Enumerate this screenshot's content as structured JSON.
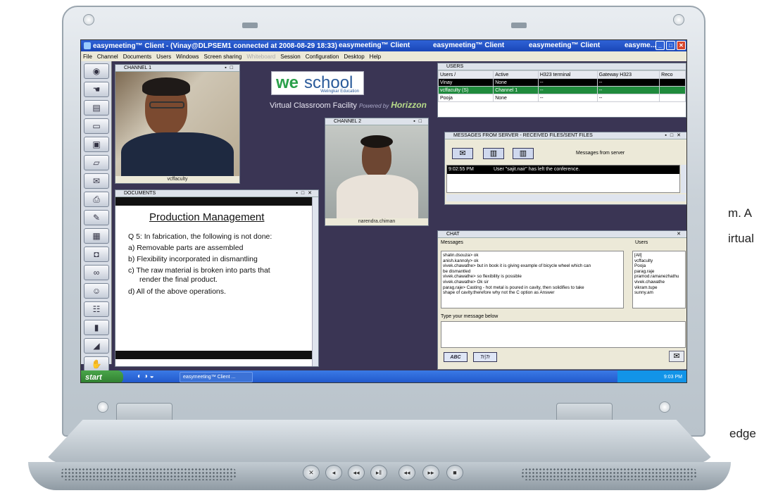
{
  "background_text": {
    "line1": "m. A",
    "line2": "irtual",
    "line3": "edge"
  },
  "window": {
    "title": "easymeeting™ Client - (Vinay@DLPSEM1 connected at 2008-08-29 18:33)",
    "title_seg2": "easymeeting™ Client",
    "title_seg3": "easymeeting™ Client",
    "title_seg4": "easymeeting™ Client",
    "title_seg5": "easyme..."
  },
  "menu": [
    "File",
    "Channel",
    "Documents",
    "Users",
    "Windows",
    "Screen sharing",
    "Whiteboard",
    "Session",
    "Configuration",
    "Desktop",
    "Help"
  ],
  "menu_disabled": "Whiteboard",
  "logo": {
    "we": "we",
    "school": "school",
    "sub": "Welingkar Education"
  },
  "tagline": {
    "main": "Virtual Classroom Facility",
    "powered": "Powered by",
    "brand": "Horizzon"
  },
  "channel1": {
    "title": "CHANNEL 1",
    "caption": "vcffaculty"
  },
  "channel2": {
    "title": "CHANNEL 2",
    "caption": "narendra.chiman"
  },
  "documents": {
    "title": "DOCUMENTS",
    "heading": "Production Management",
    "question": "Q 5: In fabrication, the following is not done:",
    "a": "a)  Removable parts are assembled",
    "b": "b)  Flexibility incorporated in dismantling",
    "c1": "c)  The raw material is broken into parts that",
    "c2": "render the final product.",
    "d": "d)  All of the above operations."
  },
  "users": {
    "title": "USERS",
    "headers": [
      "Users /",
      "Active",
      "H323 terminal",
      "Gateway H323",
      "Reco"
    ],
    "rows": [
      {
        "user": "Vinay",
        "active": "None",
        "h323": "--",
        "gw": "--"
      },
      {
        "user": "vcffaculty (S)",
        "active": "Channel 1",
        "h323": "--",
        "gw": "--"
      },
      {
        "user": "Pooja",
        "active": "None",
        "h323": "--",
        "gw": "--"
      }
    ]
  },
  "messages": {
    "title": "MESSAGES FROM SERVER - RECEIVED FILES/SENT FILES",
    "label": "Messages from server",
    "time": "9:02:55 PM",
    "text": "User \"sajit.nair\" has left the conference."
  },
  "chat": {
    "title": "CHAT",
    "messages_label": "Messages",
    "users_label": "Users",
    "lines": [
      "shalin.dsouza> ok",
      "anish.kannoly> ok",
      "vivek.chawathe> but in book it is giving example of bicycle wheel which can",
      "be dismantled",
      "vivek.chawathe> so flexibility is possible",
      "vivek.chawathe> Ok sir",
      "parag.raje> Casting - hot metal is poured in cavity, then solidifies to take",
      "shape of cavity.therefore why not the C option as Answer"
    ],
    "users": [
      "[All]",
      "vcffaculty",
      "Pooja",
      "parag.raje",
      "pramod.ramanezhathu",
      "vivek.chawathe",
      "vikram.tupe",
      "sunny.am"
    ],
    "type_label": "Type your message below",
    "btn1": "ABC",
    "btn2": "Tr|Tr"
  },
  "taskbar": {
    "start": "start",
    "item": "easymeeting™ Client ...",
    "time": "9:03 PM"
  },
  "colors": {
    "desktop": "#3a3554",
    "titlebar": "#1a46b8",
    "active_row": "#1f8a3c",
    "selected_row": "#000000"
  }
}
